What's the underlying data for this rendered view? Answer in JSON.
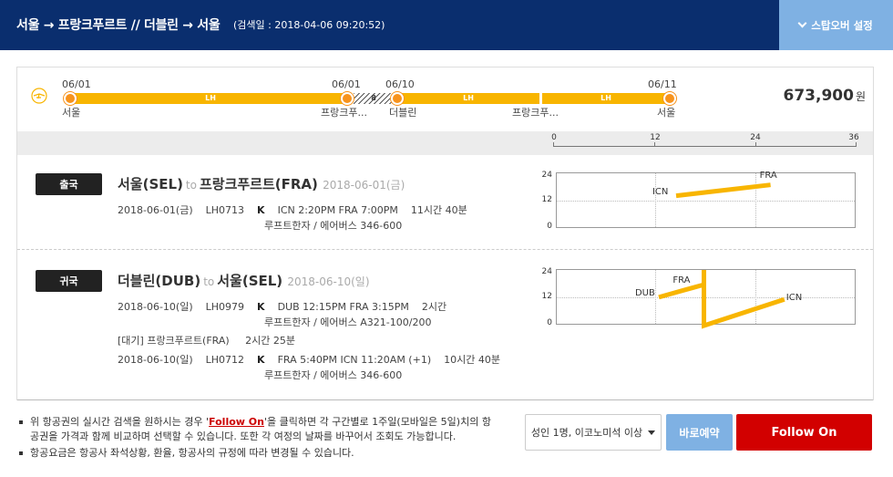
{
  "header": {
    "route": "서울 → 프랑크푸르트 // 더블린 → 서울",
    "search_date": "(검색일 : 2018-04-06 09:20:52)",
    "stopover_label": "스탑오버 설정"
  },
  "summary": {
    "airline_icon": "lufthansa-crane-icon",
    "stops": [
      {
        "date": "06/01",
        "city": "서울"
      },
      {
        "date": "06/01",
        "city": "프랑크푸..."
      },
      {
        "date": "06/10",
        "city": "더블린"
      },
      {
        "date": "",
        "city": "프랑크푸..."
      },
      {
        "date": "06/11",
        "city": "서울"
      }
    ],
    "segments": [
      {
        "carrier": "LH"
      },
      {
        "carrier": "LH"
      },
      {
        "carrier": "LH"
      }
    ],
    "layover_label": "8",
    "price": "673,900",
    "currency": "원"
  },
  "time_axis": {
    "ticks": [
      "0",
      "12",
      "24",
      "36"
    ]
  },
  "outbound": {
    "badge": "출국",
    "origin": "서울(SEL)",
    "to": "to",
    "destination": "프랑크푸르트(FRA)",
    "date": "2018-06-01(금)",
    "flights": [
      {
        "date": "2018-06-01(금)",
        "flight_no": "LH0713",
        "class": "K",
        "schedule": "ICN 2:20PM FRA 7:00PM",
        "duration": "11시간 40분",
        "aircraft": "루프트한자 / 에어버스 346-600"
      }
    ],
    "chart": {
      "y_ticks": [
        "24",
        "12",
        "0"
      ],
      "points": [
        {
          "label": "ICN",
          "x": 14.33,
          "y": 14.33
        },
        {
          "label": "FRA",
          "x": 25.67,
          "y": 19
        }
      ]
    }
  },
  "inbound": {
    "badge": "귀국",
    "origin": "더블린(DUB)",
    "to": "to",
    "destination": "서울(SEL)",
    "date": "2018-06-10(일)",
    "flights": [
      {
        "date": "2018-06-10(일)",
        "flight_no": "LH0979",
        "class": "K",
        "schedule": "DUB 12:15PM FRA 3:15PM",
        "duration": "2시간",
        "aircraft": "루프트한자 / 에어버스 A321-100/200"
      },
      {
        "date": "2018-06-10(일)",
        "flight_no": "LH0712",
        "class": "K",
        "schedule": "FRA 5:40PM ICN 11:20AM (+1)",
        "duration": "10시간 40분",
        "aircraft": "루프트한자 / 에어버스 346-600"
      }
    ],
    "layover": "[대기] 프랑크푸르트(FRA)     2시간 25분",
    "chart": {
      "y_ticks": [
        "24",
        "12",
        "0"
      ],
      "points": [
        {
          "label": "DUB",
          "x": 12.25,
          "y": 12.25
        },
        {
          "label": "FRA",
          "x": 15.25,
          "y": 15.25
        },
        {
          "label": "",
          "x": 17.67,
          "y": 17.67
        },
        {
          "label": "ICN",
          "x": 27.33,
          "y": 11.33
        }
      ]
    }
  },
  "notes": {
    "note1_pre": "위 항공권의 실시간 검색을 원하시는 경우 '",
    "note1_link": "Follow On",
    "note1_post": "'을 클릭하면 각 구간별로 1주일(모바일은 5일)치의 항공권을 가격과 함께 비교하며 선택할 수 있습니다. 또한 각 여정의 날짜를 바꾸어서 조회도 가능합니다.",
    "note2": "항공요금은 항공사 좌석상황, 환율, 항공사의 규정에 따라 변경될 수 있습니다."
  },
  "actions": {
    "pax_label": "성인 1명, 이코노미석 이상",
    "reserve_label": "바로예약",
    "follow_label": "Follow On"
  },
  "colors": {
    "header_bg": "#0a2e6e",
    "accent_blue": "#7fb1e3",
    "bar": "#f8b500",
    "dot": "#f7931d",
    "follow": "#d20000"
  }
}
